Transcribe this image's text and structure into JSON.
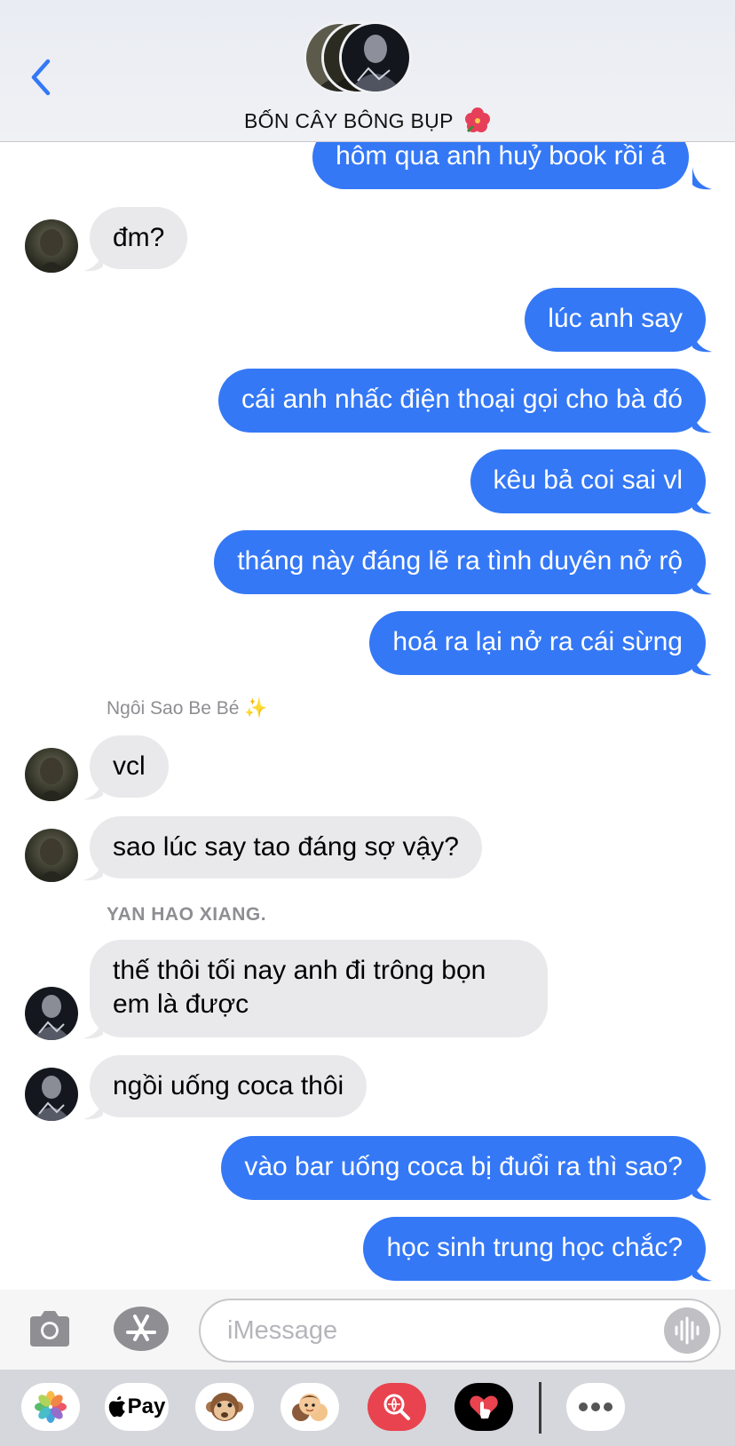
{
  "header": {
    "title": "BỐN CÂY BÔNG BỤP",
    "back_icon": "chevron-left-icon",
    "title_emoji": "hibiscus-icon"
  },
  "messages": [
    {
      "side": "out",
      "text": "hôm qua anh huỷ book rồi á"
    },
    {
      "side": "in",
      "text": "đm?"
    },
    {
      "side": "out",
      "text": "lúc anh say"
    },
    {
      "side": "out",
      "text": "cái anh nhấc điện thoại gọi cho bà đó"
    },
    {
      "side": "out",
      "text": "kêu bả coi sai vl"
    },
    {
      "side": "out",
      "text": "tháng này đáng lẽ ra tình duyên nở rộ"
    },
    {
      "side": "out",
      "text": "hoá ra lại nở ra cái sừng"
    },
    {
      "side": "sender",
      "text": "Ngôi Sao Be Bé ✨"
    },
    {
      "side": "in",
      "text": "vcl"
    },
    {
      "side": "in",
      "text": "sao lúc say tao đáng sợ vậy?"
    },
    {
      "side": "sender",
      "text": "YAN HAO XIANG."
    },
    {
      "side": "in",
      "text": "thế thôi tối nay anh đi trông bọn em là được"
    },
    {
      "side": "in",
      "text": "ngồi uống coca thôi"
    },
    {
      "side": "out",
      "text": "vào bar uống coca bị đuổi ra thì sao?"
    },
    {
      "side": "out",
      "text": "học sinh trung học chắc?"
    }
  ],
  "composer": {
    "placeholder": "iMessage",
    "camera_icon": "camera-icon",
    "apps_icon": "app-store-icon",
    "audio_icon": "audio-waveform-icon"
  },
  "app_strip": {
    "apple_pay_label": "Pay",
    "items": [
      "photos-icon",
      "apple-pay-icon",
      "monkey-animoji-icon",
      "memoji-icon",
      "web-search-icon",
      "digital-touch-icon",
      "more-icon"
    ]
  },
  "colors": {
    "outgoing_bubble": "#3478f6",
    "incoming_bubble": "#e9e9eb",
    "accent": "#3478f6"
  }
}
